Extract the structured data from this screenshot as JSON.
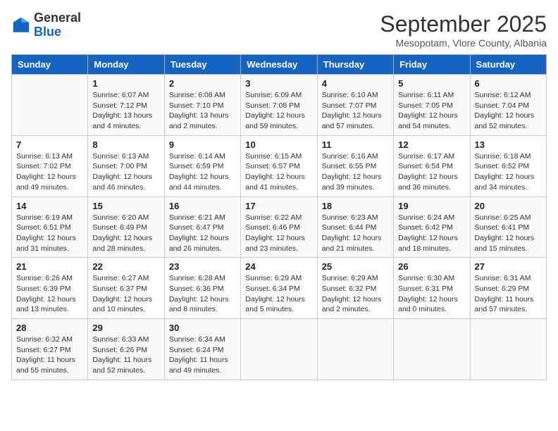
{
  "header": {
    "logo_general": "General",
    "logo_blue": "Blue",
    "month_title": "September 2025",
    "location": "Mesopotam, Vlore County, Albania"
  },
  "days_of_week": [
    "Sunday",
    "Monday",
    "Tuesday",
    "Wednesday",
    "Thursday",
    "Friday",
    "Saturday"
  ],
  "weeks": [
    [
      {
        "day": "",
        "info": ""
      },
      {
        "day": "1",
        "info": "Sunrise: 6:07 AM\nSunset: 7:12 PM\nDaylight: 13 hours\nand 4 minutes."
      },
      {
        "day": "2",
        "info": "Sunrise: 6:08 AM\nSunset: 7:10 PM\nDaylight: 13 hours\nand 2 minutes."
      },
      {
        "day": "3",
        "info": "Sunrise: 6:09 AM\nSunset: 7:08 PM\nDaylight: 12 hours\nand 59 minutes."
      },
      {
        "day": "4",
        "info": "Sunrise: 6:10 AM\nSunset: 7:07 PM\nDaylight: 12 hours\nand 57 minutes."
      },
      {
        "day": "5",
        "info": "Sunrise: 6:11 AM\nSunset: 7:05 PM\nDaylight: 12 hours\nand 54 minutes."
      },
      {
        "day": "6",
        "info": "Sunrise: 6:12 AM\nSunset: 7:04 PM\nDaylight: 12 hours\nand 52 minutes."
      }
    ],
    [
      {
        "day": "7",
        "info": "Sunrise: 6:13 AM\nSunset: 7:02 PM\nDaylight: 12 hours\nand 49 minutes."
      },
      {
        "day": "8",
        "info": "Sunrise: 6:13 AM\nSunset: 7:00 PM\nDaylight: 12 hours\nand 46 minutes."
      },
      {
        "day": "9",
        "info": "Sunrise: 6:14 AM\nSunset: 6:59 PM\nDaylight: 12 hours\nand 44 minutes."
      },
      {
        "day": "10",
        "info": "Sunrise: 6:15 AM\nSunset: 6:57 PM\nDaylight: 12 hours\nand 41 minutes."
      },
      {
        "day": "11",
        "info": "Sunrise: 6:16 AM\nSunset: 6:55 PM\nDaylight: 12 hours\nand 39 minutes."
      },
      {
        "day": "12",
        "info": "Sunrise: 6:17 AM\nSunset: 6:54 PM\nDaylight: 12 hours\nand 36 minutes."
      },
      {
        "day": "13",
        "info": "Sunrise: 6:18 AM\nSunset: 6:52 PM\nDaylight: 12 hours\nand 34 minutes."
      }
    ],
    [
      {
        "day": "14",
        "info": "Sunrise: 6:19 AM\nSunset: 6:51 PM\nDaylight: 12 hours\nand 31 minutes."
      },
      {
        "day": "15",
        "info": "Sunrise: 6:20 AM\nSunset: 6:49 PM\nDaylight: 12 hours\nand 28 minutes."
      },
      {
        "day": "16",
        "info": "Sunrise: 6:21 AM\nSunset: 6:47 PM\nDaylight: 12 hours\nand 26 minutes."
      },
      {
        "day": "17",
        "info": "Sunrise: 6:22 AM\nSunset: 6:46 PM\nDaylight: 12 hours\nand 23 minutes."
      },
      {
        "day": "18",
        "info": "Sunrise: 6:23 AM\nSunset: 6:44 PM\nDaylight: 12 hours\nand 21 minutes."
      },
      {
        "day": "19",
        "info": "Sunrise: 6:24 AM\nSunset: 6:42 PM\nDaylight: 12 hours\nand 18 minutes."
      },
      {
        "day": "20",
        "info": "Sunrise: 6:25 AM\nSunset: 6:41 PM\nDaylight: 12 hours\nand 15 minutes."
      }
    ],
    [
      {
        "day": "21",
        "info": "Sunrise: 6:26 AM\nSunset: 6:39 PM\nDaylight: 12 hours\nand 13 minutes."
      },
      {
        "day": "22",
        "info": "Sunrise: 6:27 AM\nSunset: 6:37 PM\nDaylight: 12 hours\nand 10 minutes."
      },
      {
        "day": "23",
        "info": "Sunrise: 6:28 AM\nSunset: 6:36 PM\nDaylight: 12 hours\nand 8 minutes."
      },
      {
        "day": "24",
        "info": "Sunrise: 6:29 AM\nSunset: 6:34 PM\nDaylight: 12 hours\nand 5 minutes."
      },
      {
        "day": "25",
        "info": "Sunrise: 6:29 AM\nSunset: 6:32 PM\nDaylight: 12 hours\nand 2 minutes."
      },
      {
        "day": "26",
        "info": "Sunrise: 6:30 AM\nSunset: 6:31 PM\nDaylight: 12 hours\nand 0 minutes."
      },
      {
        "day": "27",
        "info": "Sunrise: 6:31 AM\nSunset: 6:29 PM\nDaylight: 11 hours\nand 57 minutes."
      }
    ],
    [
      {
        "day": "28",
        "info": "Sunrise: 6:32 AM\nSunset: 6:27 PM\nDaylight: 11 hours\nand 55 minutes."
      },
      {
        "day": "29",
        "info": "Sunrise: 6:33 AM\nSunset: 6:26 PM\nDaylight: 11 hours\nand 52 minutes."
      },
      {
        "day": "30",
        "info": "Sunrise: 6:34 AM\nSunset: 6:24 PM\nDaylight: 11 hours\nand 49 minutes."
      },
      {
        "day": "",
        "info": ""
      },
      {
        "day": "",
        "info": ""
      },
      {
        "day": "",
        "info": ""
      },
      {
        "day": "",
        "info": ""
      }
    ]
  ]
}
